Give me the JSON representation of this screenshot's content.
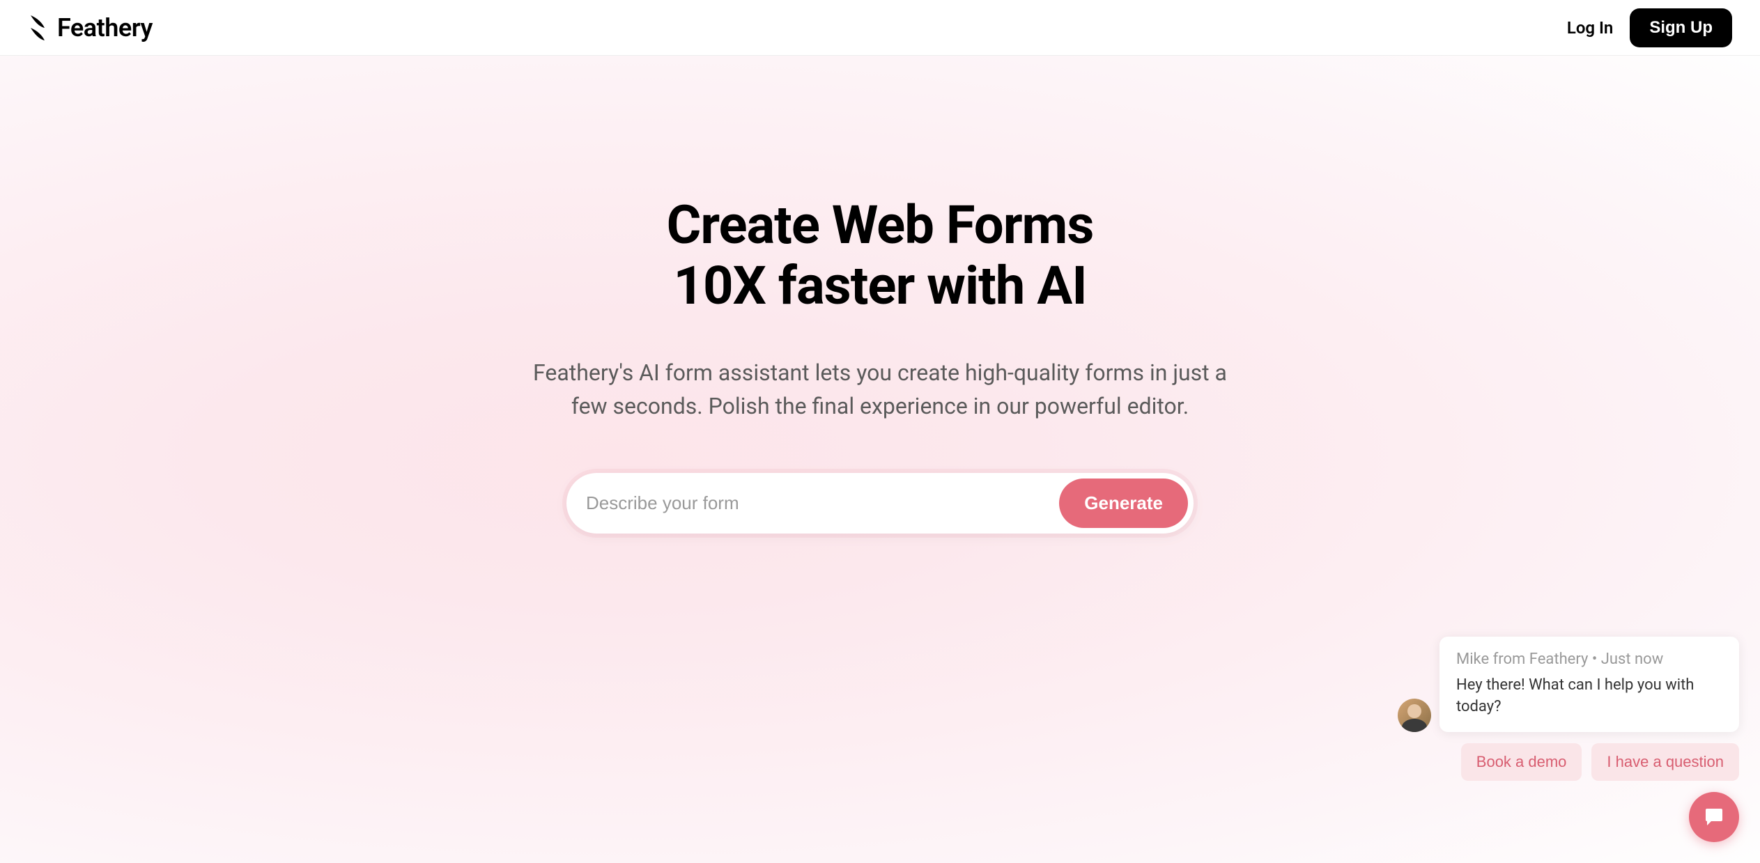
{
  "header": {
    "brand": "Feathery",
    "login_label": "Log In",
    "signup_label": "Sign Up"
  },
  "hero": {
    "title_line1": "Create Web Forms",
    "title_line2": "10X faster with AI",
    "subtitle": "Feathery's AI form assistant lets you create high-quality forms in just a few seconds. Polish the final experience in our powerful editor.",
    "input_placeholder": "Describe your form",
    "generate_label": "Generate"
  },
  "chat": {
    "sender": "Mike from Feathery",
    "timestamp": "Just now",
    "message": "Hey there! What can I help you with today?",
    "action_demo": "Book a demo",
    "action_question": "I have a question"
  }
}
